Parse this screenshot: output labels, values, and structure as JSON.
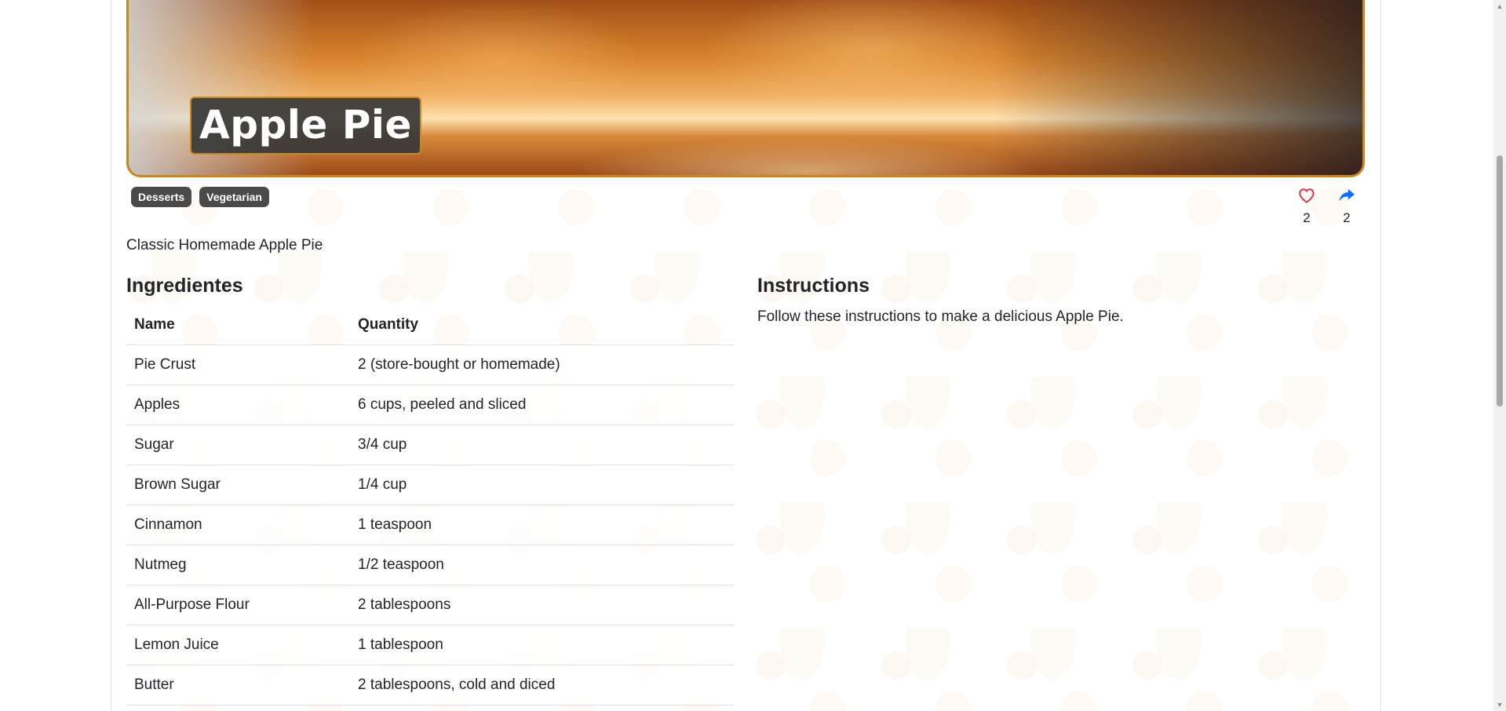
{
  "recipe": {
    "title": "Apple Pie",
    "tags": [
      "Desserts",
      "Vegetarian"
    ],
    "summary": "Classic Homemade Apple Pie",
    "likes": "2",
    "shares": "2"
  },
  "ingredients": {
    "heading": "Ingredientes",
    "columns": {
      "name": "Name",
      "quantity": "Quantity"
    },
    "rows": [
      {
        "name": "Pie Crust",
        "quantity": "2 (store-bought or homemade)"
      },
      {
        "name": "Apples",
        "quantity": "6 cups, peeled and sliced"
      },
      {
        "name": "Sugar",
        "quantity": "3/4 cup"
      },
      {
        "name": "Brown Sugar",
        "quantity": "1/4 cup"
      },
      {
        "name": "Cinnamon",
        "quantity": "1 teaspoon"
      },
      {
        "name": "Nutmeg",
        "quantity": "1/2 teaspoon"
      },
      {
        "name": "All-Purpose Flour",
        "quantity": "2 tablespoons"
      },
      {
        "name": "Lemon Juice",
        "quantity": "1 tablespoon"
      },
      {
        "name": "Butter",
        "quantity": "2 tablespoons, cold and diced"
      }
    ]
  },
  "instructions": {
    "heading": "Instructions",
    "text": "Follow these instructions to make a delicious Apple Pie."
  },
  "colors": {
    "accent": "#c8871f",
    "like": "#dc3545",
    "share": "#0d6efd",
    "tag_bg": "#4a4a4a"
  }
}
